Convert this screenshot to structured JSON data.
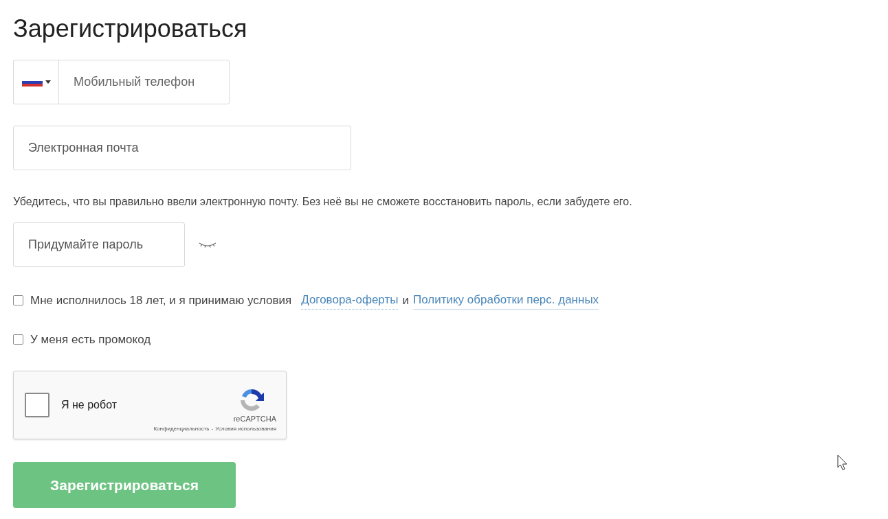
{
  "title": "Зарегистрироваться",
  "phone": {
    "placeholder": "Мобильный телефон"
  },
  "email": {
    "placeholder": "Электронная почта"
  },
  "email_note": "Убедитесь, что вы правильно ввели электронную почту. Без неё вы не сможете восстановить пароль, если забудете его.",
  "password": {
    "placeholder": "Придумайте пароль"
  },
  "agreement": {
    "checked": false,
    "text": "Мне исполнилось 18 лет, и я принимаю условия",
    "link1": "Договора-оферты",
    "joiner": "и",
    "link2": "Политику обработки перс. данных"
  },
  "promo": {
    "checked": false,
    "label": "У меня есть промокод"
  },
  "captcha": {
    "checked": false,
    "label": "Я не робот",
    "brand": "reCAPTCHA",
    "privacy": "Конфиденциальность",
    "separator": "-",
    "terms": "Условия использования"
  },
  "submit": {
    "label": "Зарегистрироваться"
  }
}
